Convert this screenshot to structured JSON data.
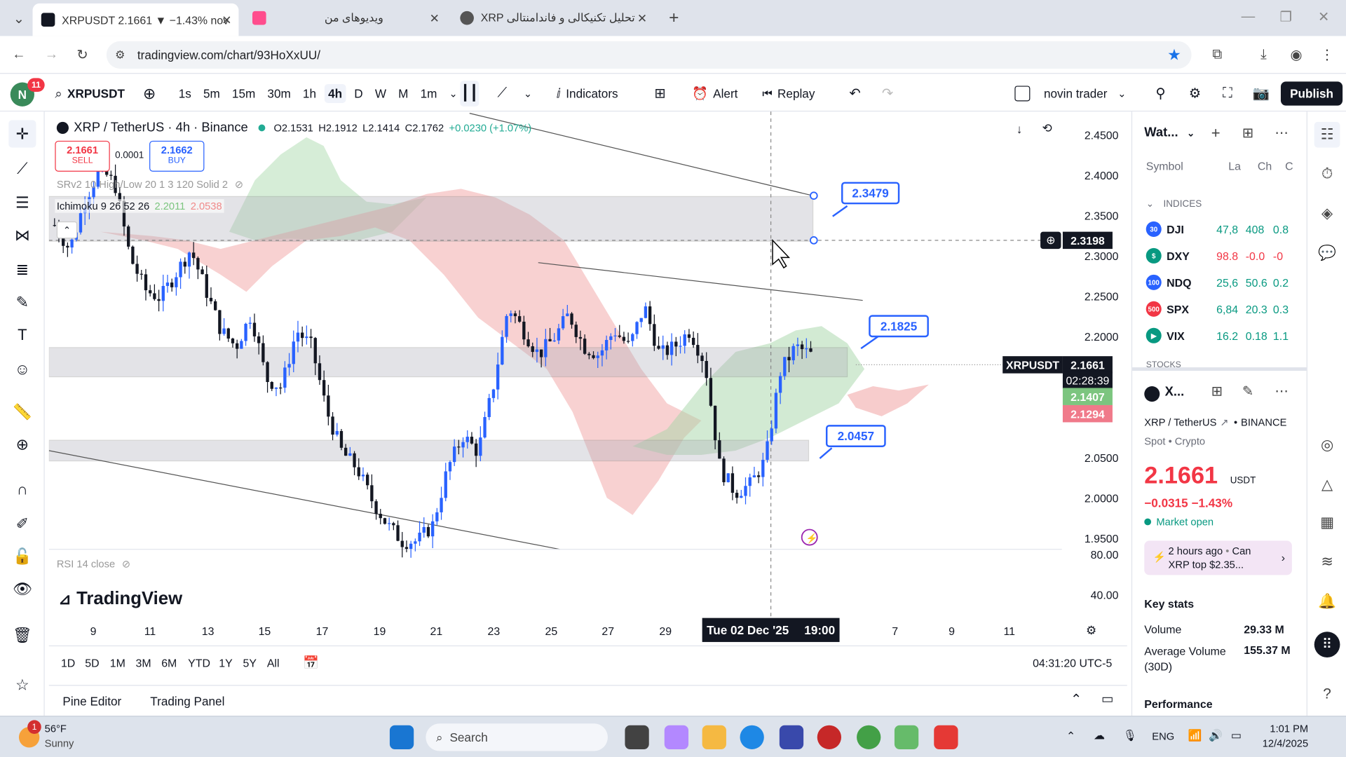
{
  "browser": {
    "tabs": [
      {
        "title": "XRPUSDT 2.1661 ▼ −1.43% nov",
        "active": true
      },
      {
        "title": "ویدیوهای من",
        "active": false
      },
      {
        "title": "XRP تحلیل تکنیکالی و فاندامنتالی",
        "active": false
      }
    ],
    "url": "tradingview.com/chart/93HoXxUU/"
  },
  "toolbar": {
    "avatar_letter": "N",
    "notif_count": "11",
    "symbol": "XRPUSDT",
    "intervals": [
      "1s",
      "5m",
      "15m",
      "30m",
      "1h",
      "4h",
      "D",
      "W",
      "M",
      "1m"
    ],
    "selected_interval": "4h",
    "indicators_label": "Indicators",
    "alert_label": "Alert",
    "replay_label": "Replay",
    "layout_name": "novin trader",
    "publish_label": "Publish"
  },
  "legend": {
    "title": "XRP / TetherUS · 4h · Binance",
    "o": "O2.1531",
    "h": "H2.1912",
    "l": "L2.1414",
    "c": "C2.1762",
    "change": "+0.0230 (+1.07%)",
    "sell_price": "2.1661",
    "sell_label": "SELL",
    "spread": "0.0001",
    "buy_price": "2.1662",
    "buy_label": "BUY",
    "srv_label": "SRv2 10 High/Low 20 1 3 120 Solid 2",
    "ichimoku_label": "Ichimoku 9 26 52 26",
    "ichimoku_v1": "2.2011",
    "ichimoku_v2": "2.0538",
    "rsi_label": "RSI 14 close"
  },
  "chart_data": {
    "type": "candlestick",
    "symbol": "XRP / TetherUS · 4h · Binance",
    "price_ticks": [
      "2.4500",
      "2.4000",
      "2.3500",
      "2.3000",
      "2.2500",
      "2.2000",
      "2.0500",
      "2.0000",
      "1.9500"
    ],
    "rsi_ticks": [
      "80.00",
      "40.00"
    ],
    "time_ticks": [
      "9",
      "11",
      "13",
      "15",
      "17",
      "19",
      "21",
      "23",
      "25",
      "27",
      "29",
      "7",
      "9",
      "11"
    ],
    "crosshair_time": "Tue 02 Dec '25",
    "crosshair_hour": "19:00",
    "crosshair_price": "2.3198",
    "last_price": "2.1661",
    "countdown": "02:28:39",
    "ichimoku_a": "2.1407",
    "ichimoku_b": "2.1294",
    "annotations": [
      "2.3479",
      "2.1825",
      "2.0457"
    ],
    "ylim": [
      1.93,
      2.47
    ]
  },
  "tags": {
    "crosshair": "2.3198",
    "symbol": "XRPUSDT",
    "price": "2.1661",
    "countdown": "02:28:39",
    "green": "2.1407",
    "red": "2.1294"
  },
  "ranges": [
    "1D",
    "5D",
    "1M",
    "3M",
    "6M",
    "YTD",
    "1Y",
    "5Y",
    "All"
  ],
  "clock": "04:31:20 UTC-5",
  "bottom_tabs": [
    "Pine Editor",
    "Trading Panel"
  ],
  "watchlist": {
    "title": "Wat...",
    "col_symbol": "Symbol",
    "col_last": "La",
    "col_chg": "Ch",
    "col_chgp": "C",
    "section": "INDICES",
    "section2": "STOCKS",
    "rows": [
      {
        "badge": "30",
        "color": "#2962ff",
        "sym": "DJI",
        "last": "47,8",
        "chg": "408",
        "chgp": "0.8",
        "up": true
      },
      {
        "badge": "$",
        "color": "#089981",
        "sym": "DXY",
        "last": "98.8",
        "chg": "-0.0",
        "chgp": "-0",
        "up": false
      },
      {
        "badge": "100",
        "color": "#2962ff",
        "sym": "NDQ",
        "last": "25,6",
        "chg": "50.6",
        "chgp": "0.2",
        "up": true
      },
      {
        "badge": "500",
        "color": "#f23645",
        "sym": "SPX",
        "last": "6,84",
        "chg": "20.3",
        "chgp": "0.3",
        "up": true
      },
      {
        "badge": "▶",
        "color": "#089981",
        "sym": "VIX",
        "last": "16.2",
        "chg": "0.18",
        "chgp": "1.1",
        "up": true
      }
    ]
  },
  "details": {
    "short": "X...",
    "name": "XRP / TetherUS",
    "exchange": "BINANCE",
    "type": "Spot • Crypto",
    "price": "2.1661",
    "currency": "USDT",
    "change": "−0.0315  −1.43%",
    "market": "Market open",
    "news_time": "2 hours ago",
    "news_snip": "Can",
    "news_title": "XRP top $2.35...",
    "key_stats": "Key stats",
    "volume_label": "Volume",
    "volume": "29.33 M",
    "avg_vol_label": "Average Volume (30D)",
    "avg_vol": "155.37 M",
    "performance": "Performance"
  },
  "taskbar": {
    "temp": "56°F",
    "weather": "Sunny",
    "search": "Search",
    "lang": "ENG",
    "time": "1:01 PM",
    "date": "12/4/2025",
    "badge": "1"
  },
  "brand": "TradingView"
}
